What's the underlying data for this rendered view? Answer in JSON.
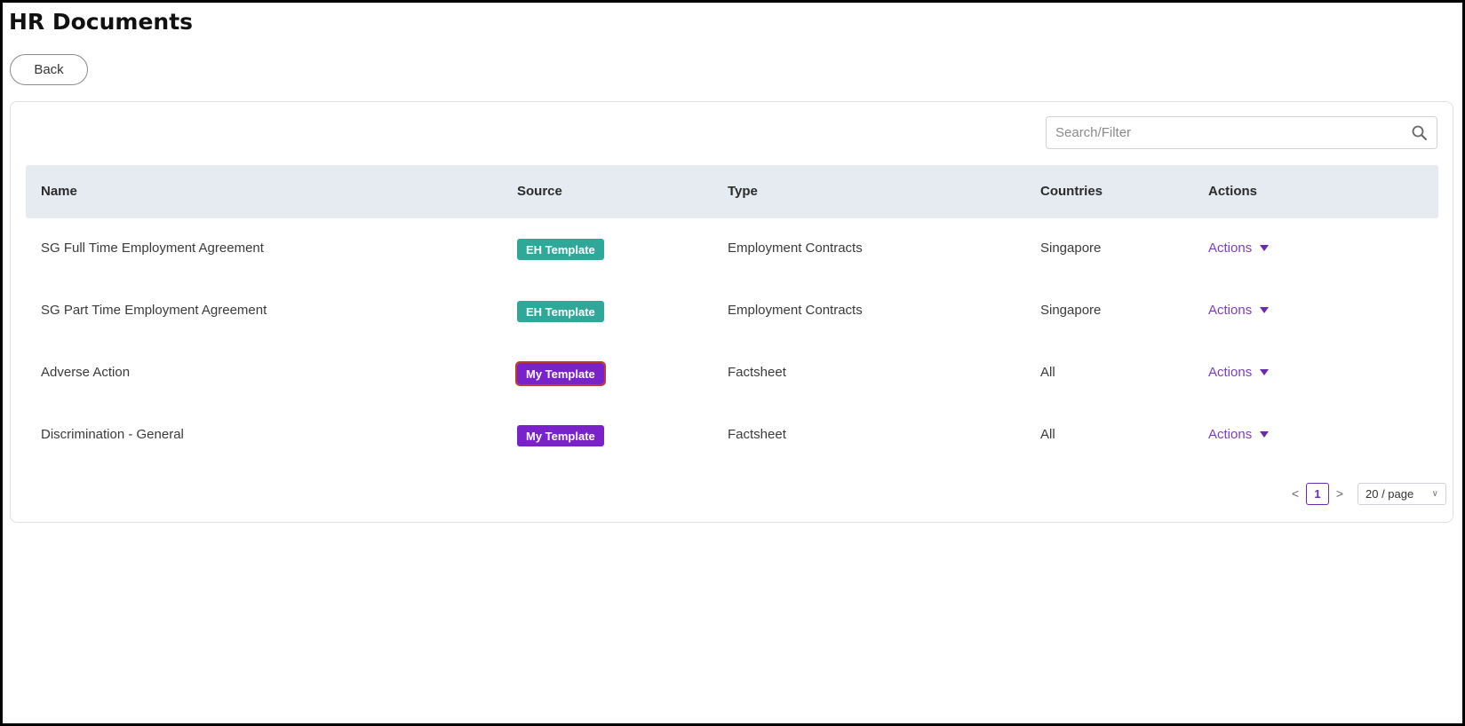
{
  "header": {
    "title": "HR Documents",
    "back_label": "Back"
  },
  "search": {
    "placeholder": "Search/Filter",
    "value": ""
  },
  "table": {
    "columns": [
      "Name",
      "Source",
      "Type",
      "Countries",
      "Actions"
    ],
    "rows": [
      {
        "name": "SG Full Time Employment Agreement",
        "source": "EH Template",
        "source_kind": "eh",
        "type": "Employment Contracts",
        "countries": "Singapore",
        "actions": "Actions"
      },
      {
        "name": "SG Part Time Employment Agreement",
        "source": "EH Template",
        "source_kind": "eh",
        "type": "Employment Contracts",
        "countries": "Singapore",
        "actions": "Actions"
      },
      {
        "name": "Adverse Action",
        "source": "My Template",
        "source_kind": "my",
        "type": "Factsheet",
        "countries": "All",
        "actions": "Actions"
      },
      {
        "name": "Discrimination - General",
        "source": "My Template",
        "source_kind": "my",
        "type": "Factsheet",
        "countries": "All",
        "actions": "Actions"
      }
    ]
  },
  "pagination": {
    "prev": "<",
    "current": "1",
    "next": ">",
    "page_size": "20 / page"
  },
  "colors": {
    "eh_badge": "#2fa89a",
    "my_badge": "#7a22c9",
    "accent": "#6a2bb0",
    "header_bg": "#e6ebf2"
  }
}
